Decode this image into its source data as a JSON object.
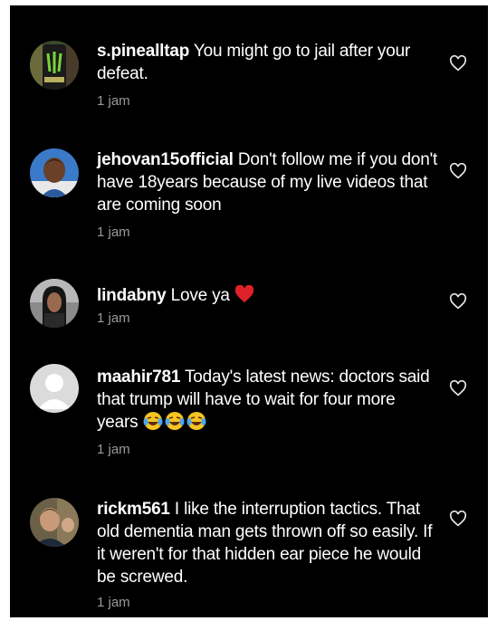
{
  "comments": [
    {
      "username": "s.pinealltap",
      "text": "You might go to jail after your defeat.",
      "time": "1 jam",
      "avatar_icon": "energy-drink-can-photo",
      "like_icon": "heart-outline-icon"
    },
    {
      "username": "jehovan15official",
      "text": "Don't follow me if you don't have 18years because of my live videos that are coming soon",
      "time": "1 jam",
      "avatar_icon": "person-photo",
      "like_icon": "heart-outline-icon"
    },
    {
      "username": "lindabny",
      "text": "Love ya",
      "emoji": "red-heart",
      "time": "1 jam",
      "avatar_icon": "woman-photo",
      "like_icon": "heart-outline-icon"
    },
    {
      "username": "maahir781",
      "text": "Today's latest news: doctors said that trump will have to wait for four more years",
      "emoji": "face-with-tears-of-joy x3",
      "time": "1 jam",
      "avatar_icon": "default-user-icon",
      "like_icon": "heart-outline-icon"
    },
    {
      "username": "rickm561",
      "text": "I like the interruption tactics. That old dementia man gets thrown off so easily. If it weren't for that hidden ear piece he would be screwed.",
      "time": "1 jam",
      "avatar_icon": "man-photo",
      "like_icon": "heart-outline-icon"
    }
  ],
  "colors": {
    "background": "#000000",
    "text": "#ffffff",
    "timestamp": "#9a9a9a",
    "heart_emoji": "#e0202a",
    "laugh_emoji": "#f5c422"
  }
}
